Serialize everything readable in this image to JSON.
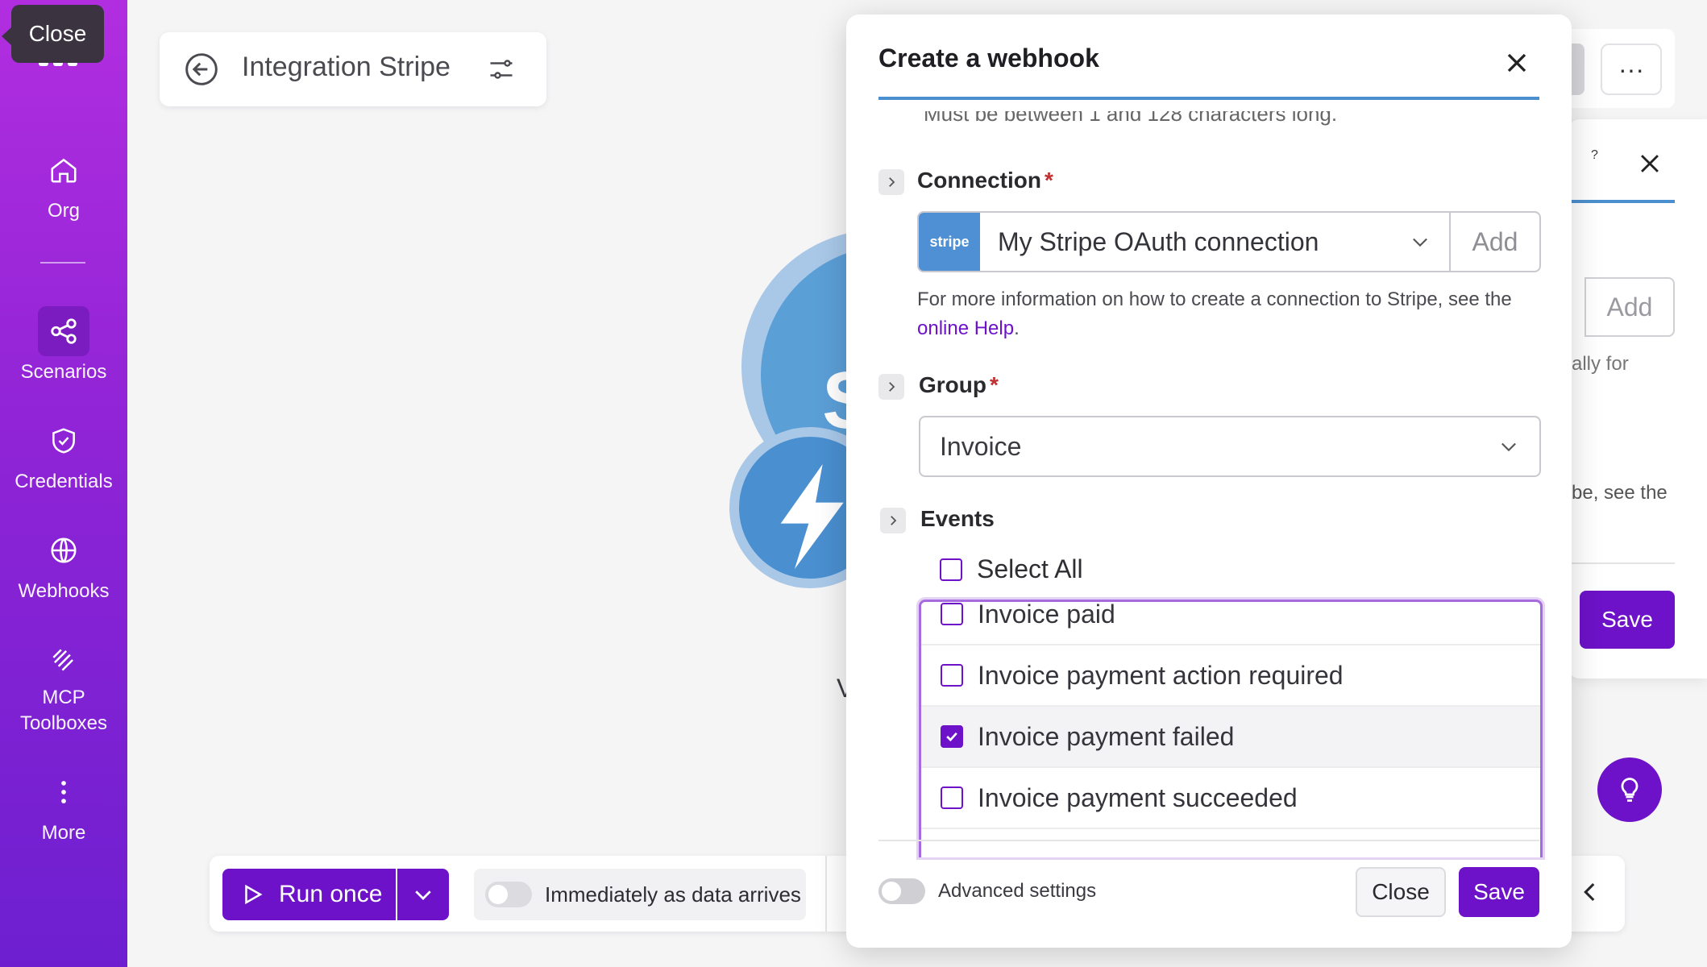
{
  "tooltip": "Close",
  "sidebar": {
    "items": [
      {
        "label": "Org",
        "icon": "home-icon"
      },
      {
        "label": "Scenarios",
        "icon": "share-icon"
      },
      {
        "label": "Credentials",
        "icon": "shield-icon"
      },
      {
        "label": "Webhooks",
        "icon": "globe-icon"
      },
      {
        "label": "MCP\nToolboxes",
        "label_line1": "MCP",
        "label_line2": "Toolboxes",
        "icon": "toolbox-icon"
      },
      {
        "label": "More",
        "icon": "more-vertical-icon"
      }
    ],
    "active": "Scenarios"
  },
  "header": {
    "title": "Integration Stripe",
    "menu": "···"
  },
  "canvas": {
    "module_letter": "S",
    "module_caption": "V"
  },
  "toolbar": {
    "run_label": "Run once",
    "schedule_label": "Immediately as data arrives"
  },
  "background_panel": {
    "help": "?",
    "add": "Add",
    "text1": "ally for",
    "text2": "be, see the",
    "save": "Save"
  },
  "dialog": {
    "title": "Create a webhook",
    "truncated_hint": "Must be between 1 and 128 characters long.",
    "connection": {
      "label": "Connection",
      "required": "*",
      "logo": "stripe",
      "value": "My Stripe OAuth connection",
      "add": "Add",
      "help_prefix": "For more information on how to create a connection to Stripe, see the ",
      "help_link": "online Help",
      "help_suffix": "."
    },
    "group": {
      "label": "Group",
      "required": "*",
      "value": "Invoice"
    },
    "events": {
      "label": "Events",
      "select_all": "Select All",
      "items": [
        {
          "label": "Invoice paid",
          "checked": false
        },
        {
          "label": "Invoice payment action required",
          "checked": false
        },
        {
          "label": "Invoice payment failed",
          "checked": true
        },
        {
          "label": "Invoice payment succeeded",
          "checked": false
        }
      ]
    },
    "advanced_settings": "Advanced settings",
    "close": "Close",
    "save": "Save"
  },
  "colors": {
    "accent": "#6d12c8",
    "sidebar_top": "#b12ee0",
    "sidebar_bottom": "#6d1fd0",
    "stripe_blue": "#4f8fd3"
  }
}
